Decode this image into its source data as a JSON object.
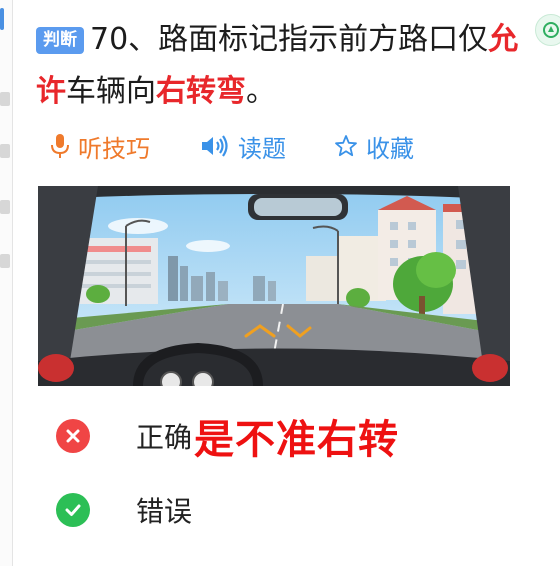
{
  "question": {
    "tag": "判断",
    "text_part1": "70、路面标记指示前方路口仅",
    "highlight1": "允许",
    "text_part2": "车辆向",
    "highlight2": "右转弯",
    "text_part3": "。"
  },
  "actions": {
    "listen_label": "听技巧",
    "read_label": "读题",
    "favorite_label": "收藏"
  },
  "options": [
    {
      "label": "正确",
      "overlay_text": "是不准右转",
      "icon": "close-icon"
    },
    {
      "label": "错误",
      "icon": "check-icon"
    }
  ],
  "colors": {
    "accent_blue": "#3a92e8",
    "accent_orange": "#ef7a2c",
    "highlight_red": "#e8272b",
    "wrong_red": "#f04545",
    "right_green": "#2cbf56"
  }
}
